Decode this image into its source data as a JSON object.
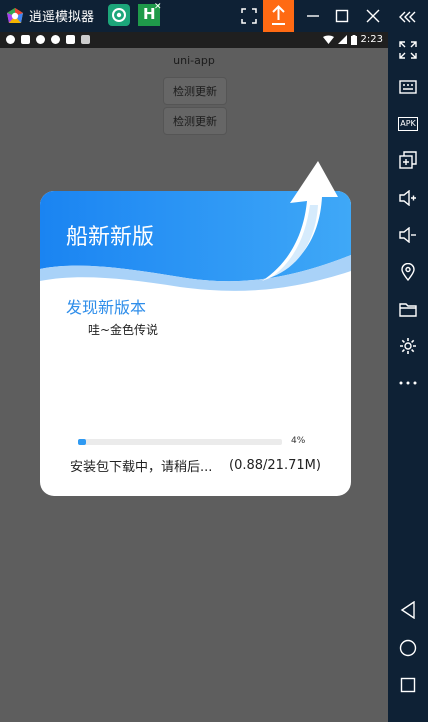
{
  "emulator": {
    "title": "逍遥模拟器",
    "tab2_label": "H",
    "tab_close": "✕"
  },
  "statusbar": {
    "time": "2:23"
  },
  "app": {
    "title": "uni-app",
    "buttons": [
      "检测更新",
      "检测更新"
    ]
  },
  "dialog": {
    "title": "船新新版",
    "discover_label": "发现新版本",
    "note": "哇~金色传说",
    "progress": 0.04,
    "progress_text": "4%",
    "status_text": "安装包下载中，请稍后...",
    "size_text": "(0.88/21.71M)"
  },
  "sidebar": {
    "apk_label": "APK"
  },
  "colors": {
    "accent": "#2f8eea",
    "header_blue": "#1e88f3",
    "orange": "#ff6a13"
  }
}
